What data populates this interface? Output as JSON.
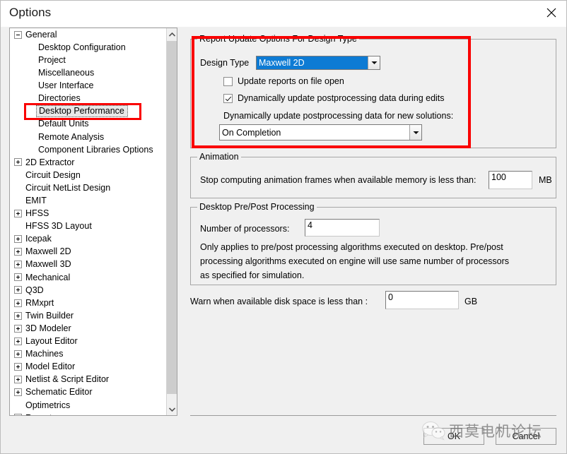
{
  "window": {
    "title": "Options",
    "close_icon": "close-icon"
  },
  "tree": {
    "items": [
      {
        "label": "General",
        "level": 0,
        "toggle": "minus",
        "selected": false
      },
      {
        "label": "Desktop Configuration",
        "level": 1,
        "toggle": "none",
        "selected": false
      },
      {
        "label": "Project",
        "level": 1,
        "toggle": "none",
        "selected": false
      },
      {
        "label": "Miscellaneous",
        "level": 1,
        "toggle": "none",
        "selected": false
      },
      {
        "label": "User Interface",
        "level": 1,
        "toggle": "none",
        "selected": false
      },
      {
        "label": "Directories",
        "level": 1,
        "toggle": "none",
        "selected": false
      },
      {
        "label": "Desktop Performance",
        "level": 1,
        "toggle": "none",
        "selected": true
      },
      {
        "label": "Default Units",
        "level": 1,
        "toggle": "none",
        "selected": false
      },
      {
        "label": "Remote Analysis",
        "level": 1,
        "toggle": "none",
        "selected": false
      },
      {
        "label": "Component Libraries Options",
        "level": 1,
        "toggle": "none",
        "selected": false
      },
      {
        "label": "2D Extractor",
        "level": 0,
        "toggle": "plus",
        "selected": false
      },
      {
        "label": "Circuit Design",
        "level": 0,
        "toggle": "none",
        "selected": false
      },
      {
        "label": "Circuit NetList Design",
        "level": 0,
        "toggle": "none",
        "selected": false
      },
      {
        "label": "EMIT",
        "level": 0,
        "toggle": "none",
        "selected": false
      },
      {
        "label": "HFSS",
        "level": 0,
        "toggle": "plus",
        "selected": false
      },
      {
        "label": "HFSS 3D Layout",
        "level": 0,
        "toggle": "none",
        "selected": false
      },
      {
        "label": "Icepak",
        "level": 0,
        "toggle": "plus",
        "selected": false
      },
      {
        "label": "Maxwell 2D",
        "level": 0,
        "toggle": "plus",
        "selected": false
      },
      {
        "label": "Maxwell 3D",
        "level": 0,
        "toggle": "plus",
        "selected": false
      },
      {
        "label": "Mechanical",
        "level": 0,
        "toggle": "plus",
        "selected": false
      },
      {
        "label": "Q3D",
        "level": 0,
        "toggle": "plus",
        "selected": false
      },
      {
        "label": "RMxprt",
        "level": 0,
        "toggle": "plus",
        "selected": false
      },
      {
        "label": "Twin Builder",
        "level": 0,
        "toggle": "plus",
        "selected": false
      },
      {
        "label": "3D Modeler",
        "level": 0,
        "toggle": "plus",
        "selected": false
      },
      {
        "label": "Layout Editor",
        "level": 0,
        "toggle": "plus",
        "selected": false
      },
      {
        "label": "Machines",
        "level": 0,
        "toggle": "plus",
        "selected": false
      },
      {
        "label": "Model Editor",
        "level": 0,
        "toggle": "plus",
        "selected": false
      },
      {
        "label": "Netlist & Script Editor",
        "level": 0,
        "toggle": "plus",
        "selected": false
      },
      {
        "label": "Schematic Editor",
        "level": 0,
        "toggle": "plus",
        "selected": false
      },
      {
        "label": "Optimetrics",
        "level": 0,
        "toggle": "none",
        "selected": false
      },
      {
        "label": "Reports",
        "level": 0,
        "toggle": "plus",
        "selected": false
      }
    ],
    "scrollbar": {
      "up_icon": "chevron-up-icon",
      "down_icon": "chevron-down-icon"
    }
  },
  "report_group": {
    "title": "Report Update Options For Design Type",
    "design_type_label": "Design Type",
    "design_type_value": "Maxwell 2D",
    "design_type_selected_color": "#0d7bd4",
    "checkbox_update_on_open": {
      "label": "Update reports on file open",
      "checked": false
    },
    "checkbox_dynamic_edits": {
      "label": "Dynamically update postprocessing data during edits",
      "checked": true
    },
    "new_solutions_label": "Dynamically update postprocessing data for new solutions:",
    "new_solutions_value": "On Completion"
  },
  "animation_group": {
    "title": "Animation",
    "label": "Stop computing animation frames when available memory is less than:",
    "value": "100",
    "unit": "MB"
  },
  "prepost_group": {
    "title": "Desktop Pre/Post Processing",
    "processors_label": "Number of processors:",
    "processors_value": "4",
    "description_line1": "Only applies to pre/post processing algorithms executed on desktop. Pre/post",
    "description_line2": "processing algorithms executed on engine will use same number of processors",
    "description_line3": "as specified for simulation."
  },
  "disk_warning": {
    "label": "Warn when available disk space is less than :",
    "value": "0",
    "unit": "GB"
  },
  "buttons": {
    "ok": "OK",
    "cancel": "Cancel"
  },
  "annotations": {
    "highlight_color": "#fa0000",
    "tree_item_highlighted": "Desktop Performance",
    "group_highlighted": "Report Update Options For Design Type"
  },
  "watermark": {
    "text": "西莫电机论坛",
    "logo": "wechat-icon"
  }
}
